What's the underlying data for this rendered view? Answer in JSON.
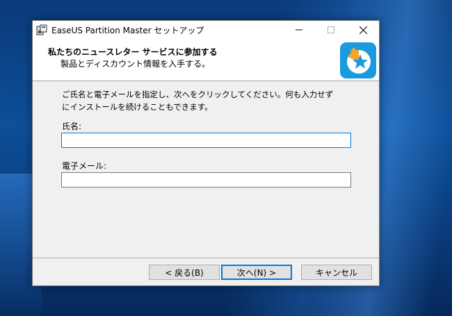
{
  "window": {
    "title": "EaseUS Partition Master セットアップ",
    "minimize_icon": "minimize-icon",
    "maximize_icon": "maximize-icon",
    "close_icon": "close-icon"
  },
  "header": {
    "title": "私たちのニュースレター サービスに参加する",
    "subtitle": "製品とディスカウント情報を入手する。",
    "logo_icon": "easeus-star-logo-icon"
  },
  "main": {
    "description_line1": "ご氏名と電子メールを指定し、次へをクリックしてください。何も入力せず",
    "description_line2": "にインストールを続けることもできます。",
    "name_label": "氏名:",
    "name_value": "",
    "email_label": "電子メール:",
    "email_value": ""
  },
  "buttons": {
    "back": "< 戻る(B)",
    "next": "次へ(N) >",
    "cancel": "キャンセル"
  },
  "colors": {
    "accent": "#0078d7",
    "logo_bg": "#1a9be0",
    "logo_orange": "#f5a623"
  }
}
